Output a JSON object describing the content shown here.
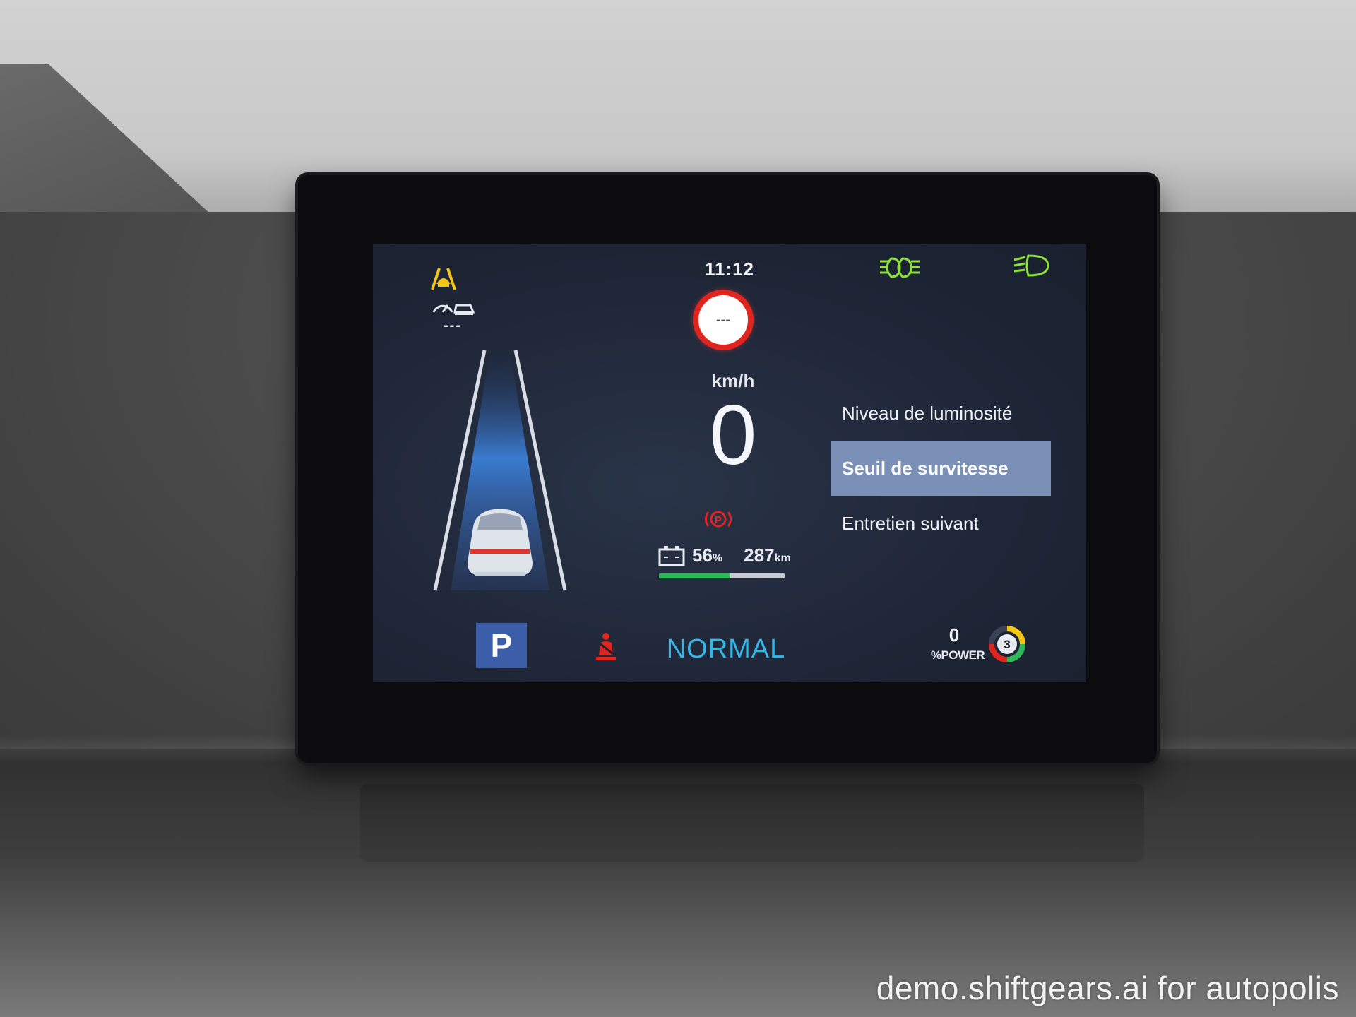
{
  "cluster": {
    "time": "11:12",
    "speed_limit_sign": "---",
    "speed_unit": "km/h",
    "speed_value": "0",
    "battery": {
      "percent": "56",
      "percent_unit": "%",
      "range": "287",
      "range_unit": "km",
      "range_level": 0.56
    },
    "adas": {
      "acc_setting": "---"
    },
    "menu": {
      "items": [
        {
          "label": "Niveau de luminosité",
          "selected": false
        },
        {
          "label": "Seuil de survitesse",
          "selected": true
        },
        {
          "label": "Entretien suivant",
          "selected": false
        }
      ]
    },
    "gear": "P",
    "drive_mode": "NORMAL",
    "power": {
      "value": "0",
      "label": "%POWER",
      "gauge_number": "3"
    },
    "colors": {
      "amber": "#f2c516",
      "green_indicator": "#8ee03a",
      "red_warning": "#e0241e",
      "mode_blue": "#36b6e6",
      "gear_blue": "#3c5ea8",
      "menu_highlight": "#7b90b6"
    },
    "icons": {
      "lane_assist": "lane-departure-icon",
      "adaptive_cruise": "adaptive-cruise-icon",
      "low_beam": "low-beam-icon",
      "auto_headlight": "auto-headlight-icon",
      "parking_brake": "parking-brake-icon",
      "seatbelt": "seatbelt-warning-icon",
      "battery": "battery-icon"
    }
  },
  "watermark": "demo.shiftgears.ai for autopolis"
}
